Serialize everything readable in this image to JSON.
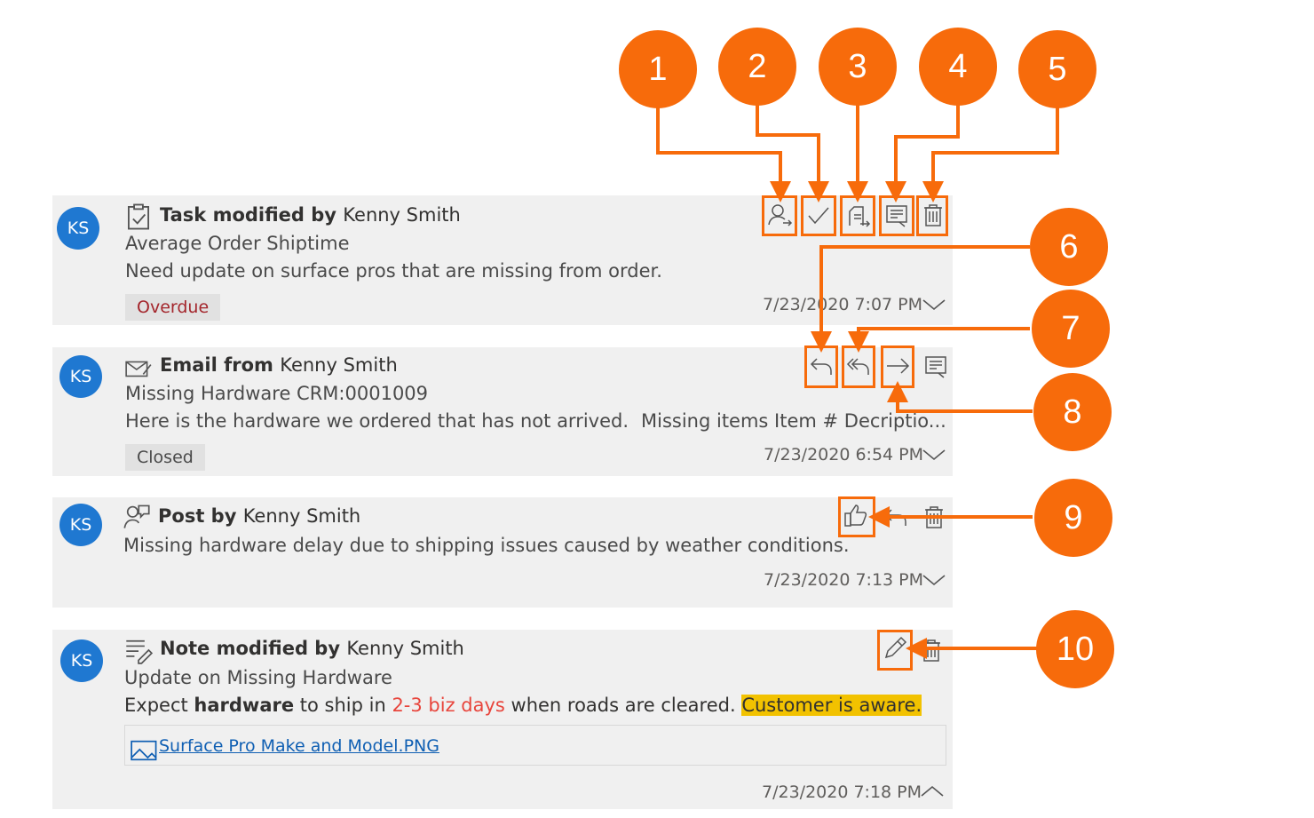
{
  "avatar_initials": "KS",
  "cards": [
    {
      "kind": "task",
      "title_prefix": "Task modified by ",
      "title_name": "Kenny Smith",
      "subject": "Average Order Shiptime",
      "body": "Need update on surface pros that are missing from order.",
      "badge": "Overdue",
      "timestamp": "7/23/2020 7:07 PM"
    },
    {
      "kind": "email",
      "title_prefix": "Email from ",
      "title_name": "Kenny Smith",
      "subject": "Missing Hardware CRM:0001009",
      "body": "Here is the hardware we ordered that has not arrived.",
      "body_extra": "Missing items Item # Decriptio...",
      "badge": "Closed",
      "timestamp": "7/23/2020 6:54 PM"
    },
    {
      "kind": "post",
      "title_prefix": "Post by ",
      "title_name": "Kenny Smith",
      "body": "Missing hardware delay due to shipping issues caused by weather conditions.",
      "timestamp": "7/23/2020 7:13 PM"
    },
    {
      "kind": "note",
      "title_prefix": "Note modified by ",
      "title_name": "Kenny Smith",
      "subject": "Update on Missing Hardware",
      "body_parts": [
        "Expect ",
        "hardware",
        " to ship in ",
        "2-3 biz days",
        " when roads are cleared. ",
        "Customer is aware."
      ],
      "attachment": "Surface Pro Make and Model.PNG",
      "timestamp": "7/23/2020 7:18 PM"
    }
  ],
  "callouts": [
    "1",
    "2",
    "3",
    "4",
    "5",
    "6",
    "7",
    "8",
    "9",
    "10"
  ],
  "icons": {
    "task_actions": [
      "assign-icon",
      "check-icon",
      "set-regarding-icon",
      "open-record-icon",
      "delete-icon"
    ],
    "email_actions": [
      "reply-icon",
      "reply-all-icon",
      "forward-icon",
      "open-record-icon"
    ],
    "post_actions": [
      "like-icon",
      "reply-icon",
      "delete-icon"
    ],
    "note_actions": [
      "edit-icon",
      "delete-icon"
    ]
  },
  "colors": {
    "accent": "#f76b0b",
    "avatar": "#1f78d1",
    "overdue": "#a4262c",
    "link": "#0f5fb3",
    "highlight": "#f2c200"
  }
}
